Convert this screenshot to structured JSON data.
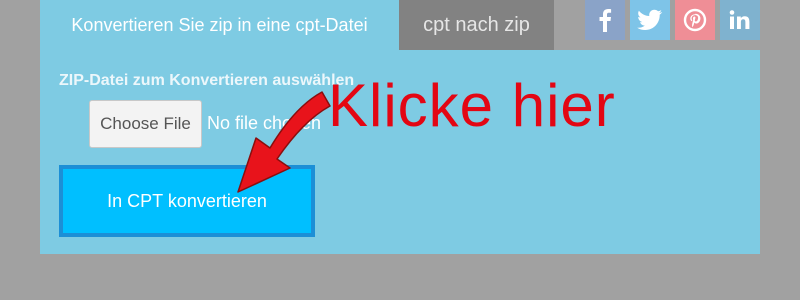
{
  "tabs": {
    "active_label": "Konvertieren Sie zip in eine cpt-Datei",
    "inactive_label": "cpt nach zip"
  },
  "social": [
    {
      "icon": "facebook-icon",
      "color": "#8aa3c8"
    },
    {
      "icon": "twitter-icon",
      "color": "#7ec4e8"
    },
    {
      "icon": "pinterest-icon",
      "color": "#ef8e96"
    },
    {
      "icon": "linkedin-icon",
      "color": "#7fb2cf"
    }
  ],
  "form": {
    "field_label": "ZIP-Datei zum Konvertieren auswählen",
    "choose_label": "Choose File",
    "file_status": "No file chosen",
    "convert_label": "In CPT konvertieren"
  },
  "annotation": {
    "text": "Klicke hier",
    "color": "#e30613"
  },
  "colors": {
    "background": "#a1a1a1",
    "panel": "#7ecbe3",
    "convert_button": "#00bfff"
  }
}
